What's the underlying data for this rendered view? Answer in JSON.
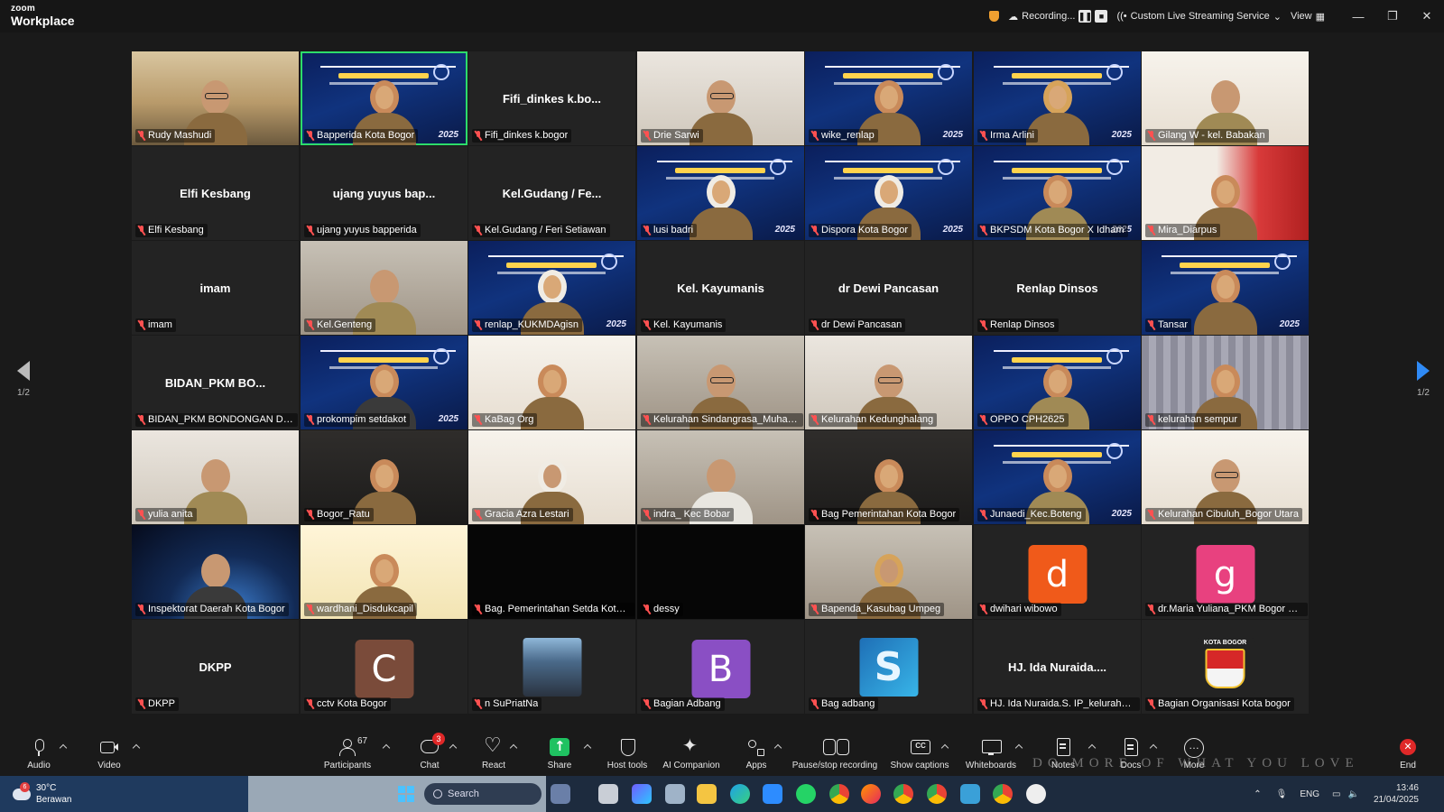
{
  "app": {
    "logo_top": "zoom",
    "logo_bottom": "Workplace",
    "recording_label": "Recording...",
    "streaming_label": "Custom Live Streaming Service",
    "view_label": "View"
  },
  "gallery": {
    "page_indicator": "1/2",
    "tiles": [
      {
        "kind": "video",
        "bg": "office",
        "person": "glasses",
        "label": "Rudy Mashudi"
      },
      {
        "kind": "banner",
        "label": "Bapperida Kota Bogor",
        "active": true,
        "year": "2025"
      },
      {
        "kind": "name",
        "center": "Fifi_dinkes  k.bo...",
        "label": "Fifi_dinkes k.bogor"
      },
      {
        "kind": "video",
        "bg": "light",
        "person": "glasses",
        "label": "Drie Sarwi"
      },
      {
        "kind": "banner",
        "label": "wike_renlap",
        "year": "2025"
      },
      {
        "kind": "banner",
        "label": "Irma Arlini",
        "person": "hijab-y",
        "year": "2025"
      },
      {
        "kind": "video",
        "bg": "cream",
        "person": "body-khaki",
        "label": "Gilang W - kel. Babakan"
      },
      {
        "kind": "name",
        "center": "Elfi Kesbang",
        "label": "Elfi Kesbang"
      },
      {
        "kind": "name",
        "center": "ujang yuyus bap...",
        "label": "ujang yuyus bapperida"
      },
      {
        "kind": "name",
        "center": "Kel.Gudang / Fe...",
        "label": "Kel.Gudang / Feri Setiawan"
      },
      {
        "kind": "banner",
        "label": "lusi badri",
        "person": "hijab-w",
        "year": "2025"
      },
      {
        "kind": "banner",
        "label": "Dispora Kota Bogor",
        "person": "hijab-w",
        "year": "2025"
      },
      {
        "kind": "banner",
        "label": "BKPSDM Kota Bogor X Idham",
        "person": "body-khaki",
        "year": "2025"
      },
      {
        "kind": "video",
        "bg": "red",
        "person": "hijab",
        "label": "Mira_Diarpus"
      },
      {
        "kind": "name",
        "center": "imam",
        "label": "imam"
      },
      {
        "kind": "video",
        "bg": "room",
        "person": "body-khaki",
        "label": "Kel.Genteng"
      },
      {
        "kind": "banner",
        "label": "renlap_KUKMDAgisn",
        "person": "hijab-w",
        "year": "2025"
      },
      {
        "kind": "name",
        "center": "Kel. Kayumanis",
        "label": "Kel. Kayumanis"
      },
      {
        "kind": "name",
        "center": "dr Dewi Pancasan",
        "label": "dr Dewi Pancasan"
      },
      {
        "kind": "name",
        "center": "Renlap Dinsos",
        "label": "Renlap Dinsos"
      },
      {
        "kind": "banner",
        "label": "Tansar",
        "year": "2025"
      },
      {
        "kind": "name",
        "center": "BIDAN_PKM  BO...",
        "label": "BIDAN_PKM BONDONGAN DINKES"
      },
      {
        "kind": "banner",
        "label": "prokompim setdakot",
        "person": "body-dark",
        "year": "2025"
      },
      {
        "kind": "video",
        "bg": "cream",
        "person": "hijab",
        "label": "KaBag Org"
      },
      {
        "kind": "video",
        "bg": "room",
        "person": "glasses",
        "label": "Kelurahan Sindangrasa_Muhamad"
      },
      {
        "kind": "video",
        "bg": "light",
        "person": "glasses",
        "label": "Kelurahan Kedunghalang"
      },
      {
        "kind": "banner",
        "label": "OPPO CPH2625",
        "person": "body-khaki",
        "year": ""
      },
      {
        "kind": "video",
        "bg": "curtain",
        "person": "hijab",
        "label": "kelurahan sempur"
      },
      {
        "kind": "video",
        "bg": "light",
        "person": "body-khaki",
        "label": "yulia anita"
      },
      {
        "kind": "video",
        "bg": "dark",
        "person": "hijab",
        "label": "Bogor_Ratu"
      },
      {
        "kind": "video",
        "bg": "cream",
        "person": "hijab-w",
        "label": "Gracia Azra Lestari"
      },
      {
        "kind": "video",
        "bg": "room",
        "person": "body-white",
        "label": "indra_ Kec Bobar"
      },
      {
        "kind": "video",
        "bg": "dark",
        "person": "hijab",
        "label": "Bag Pemerintahan Kota Bogor"
      },
      {
        "kind": "banner",
        "label": "Junaedi_Kec.Boteng",
        "person": "body-khaki",
        "year": "2025"
      },
      {
        "kind": "video",
        "bg": "cream",
        "person": "glasses",
        "label": "Kelurahan Cibuluh_Bogor Utara"
      },
      {
        "kind": "video",
        "bg": "space",
        "person": "body-dark",
        "label": "Inspektorat Daerah Kota Bogor"
      },
      {
        "kind": "video",
        "bg": "yellow",
        "person": "hijab",
        "label": "wardhani_Disdukcapil"
      },
      {
        "kind": "black",
        "label": "Bag. Pemerintahan Setda Kota B..."
      },
      {
        "kind": "black",
        "label": "dessy"
      },
      {
        "kind": "video",
        "bg": "room",
        "person": "hijab-y",
        "label": "Bapenda_Kasubag Umpeg"
      },
      {
        "kind": "avatar",
        "letter": "d",
        "color": "#f05a1a",
        "label": "dwihari wibowo"
      },
      {
        "kind": "avatar",
        "letter": "g",
        "color": "#e8417f",
        "label": "dr.Maria Yuliana_PKM Bogor Sel..."
      },
      {
        "kind": "name",
        "center": "DKPP",
        "label": "DKPP"
      },
      {
        "kind": "avatar",
        "letter": "C",
        "color": "#7a4b3a",
        "label": "cctv Kota Bogor"
      },
      {
        "kind": "photo",
        "label": "n SuPriatNa"
      },
      {
        "kind": "avatar",
        "letter": "B",
        "color": "#8a4fc4",
        "label": "Bagian Adbang"
      },
      {
        "kind": "logo_s",
        "label": "Bag adbang"
      },
      {
        "kind": "name",
        "center": "HJ. Ida Nuraida....",
        "label": "HJ. Ida Nuraida.S. IP_kelurahan t..."
      },
      {
        "kind": "crest",
        "crest_text": "KOTA BOGOR",
        "label": "Bagian Organisasi Kota bogor"
      }
    ]
  },
  "toolbar": {
    "audio": "Audio",
    "video": "Video",
    "participants": "Participants",
    "participants_count": "67",
    "chat": "Chat",
    "chat_badge": "3",
    "react": "React",
    "share": "Share",
    "host_tools": "Host tools",
    "ai_companion": "AI Companion",
    "apps": "Apps",
    "pause_recording": "Pause/stop recording",
    "captions": "Show captions",
    "whiteboards": "Whiteboards",
    "notes": "Notes",
    "docs": "Docs",
    "more": "More",
    "end": "End"
  },
  "taskbar": {
    "weather_badge": "6",
    "temperature": "30°C",
    "weather_desc": "Berawan",
    "search_label": "Search",
    "lang": "ENG",
    "time": "13:46",
    "date": "21/04/2025",
    "slogan": "DO MORE OF WHAT YOU LOVE"
  },
  "colors": {
    "active_speaker": "#2ddc6a",
    "share": "#1fc261",
    "end": "#e02828",
    "page_arrow": "#2f8af5"
  }
}
